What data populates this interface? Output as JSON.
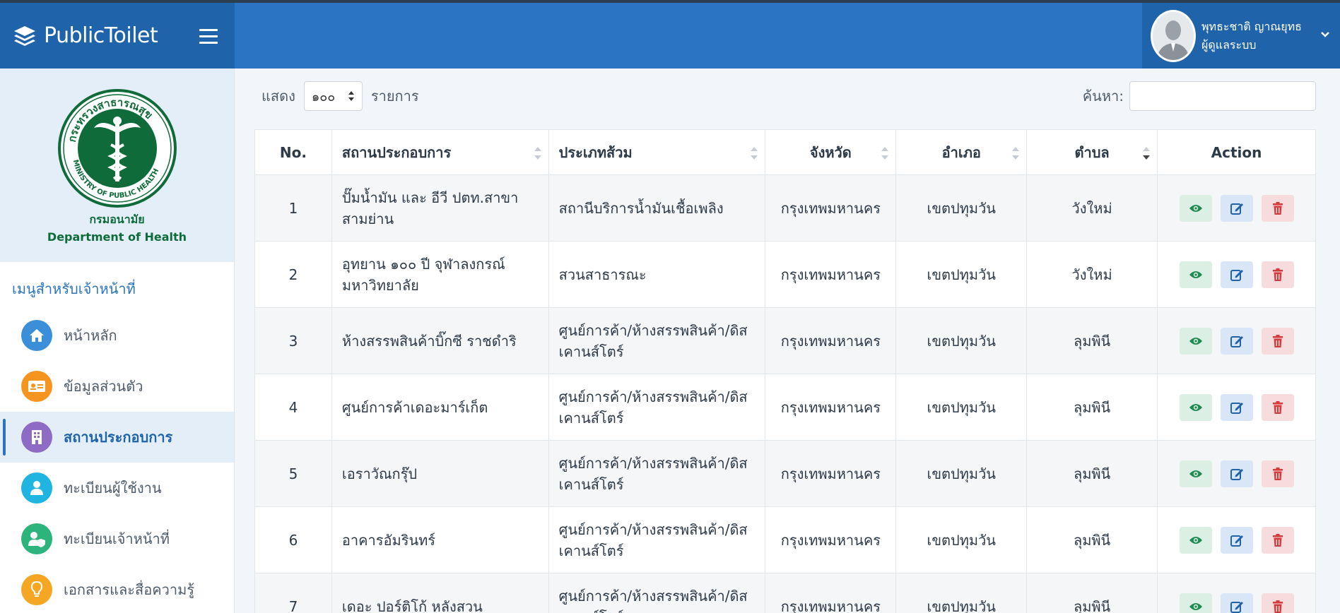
{
  "header": {
    "brand_name": "PublicToilet",
    "user_name": "พุทธะชาติ ญาณยุทธ",
    "user_role": "ผู้ดูแลระบบ"
  },
  "sidebar": {
    "org_name_th": "กรมอนามัย",
    "org_name_en": "Department of Health",
    "menu_heading": "เมนูสำหรับเจ้าหน้าที่",
    "items": [
      {
        "label": "หน้าหลัก",
        "icon": "home-icon",
        "color": "#3b8fd9"
      },
      {
        "label": "ข้อมูลส่วนตัว",
        "icon": "id-card-icon",
        "color": "#f5951f"
      },
      {
        "label": "สถานประกอบการ",
        "icon": "building-icon",
        "color": "#8e6bc4",
        "active": true
      },
      {
        "label": "ทะเบียนผู้ใช้งาน",
        "icon": "user-icon",
        "color": "#1fb5e0"
      },
      {
        "label": "ทะเบียนเจ้าหน้าที่",
        "icon": "user-shield-icon",
        "color": "#2db37c"
      },
      {
        "label": "เอกสารและสื่อความรู้",
        "icon": "lightbulb-icon",
        "color": "#f5a623"
      }
    ]
  },
  "list_controls": {
    "show_label": "แสดง",
    "page_length": "๑๐๐",
    "entries_label": "รายการ",
    "search_label": "ค้นหา:"
  },
  "table": {
    "columns": [
      "No.",
      "สถานประกอบการ",
      "ประเภทส้วม",
      "จังหวัด",
      "อำเภอ",
      "ตำบล",
      "Action"
    ],
    "rows": [
      {
        "no": "1",
        "name": "ปั๊มน้ำมัน และ อีวี ปตท.สาขาสามย่าน",
        "type": "สถานีบริการน้ำมันเชื้อเพลิง",
        "province": "กรุงเทพมหานคร",
        "district": "เขตปทุมวัน",
        "subdistrict": "วังใหม่"
      },
      {
        "no": "2",
        "name": "อุทยาน ๑๐๐ ปี จุฬาลงกรณ์มหาวิทยาลัย",
        "type": "สวนสาธารณะ",
        "province": "กรุงเทพมหานคร",
        "district": "เขตปทุมวัน",
        "subdistrict": "วังใหม่"
      },
      {
        "no": "3",
        "name": "ห้างสรรพสินค้าบิ๊กซี ราชดำริ",
        "type": "ศูนย์การค้า/ห้างสรรพสินค้า/ดิสเคานส์โตร์",
        "province": "กรุงเทพมหานคร",
        "district": "เขตปทุมวัน",
        "subdistrict": "ลุมพินี"
      },
      {
        "no": "4",
        "name": "ศูนย์การค้าเดอะมาร์เก็ต",
        "type": "ศูนย์การค้า/ห้างสรรพสินค้า/ดิสเคานส์โตร์",
        "province": "กรุงเทพมหานคร",
        "district": "เขตปทุมวัน",
        "subdistrict": "ลุมพินี"
      },
      {
        "no": "5",
        "name": "เอราวัณกรุ๊ป",
        "type": "ศูนย์การค้า/ห้างสรรพสินค้า/ดิสเคานส์โตร์",
        "province": "กรุงเทพมหานคร",
        "district": "เขตปทุมวัน",
        "subdistrict": "ลุมพินี"
      },
      {
        "no": "6",
        "name": "อาคารอัมรินทร์",
        "type": "ศูนย์การค้า/ห้างสรรพสินค้า/ดิสเคานส์โตร์",
        "province": "กรุงเทพมหานคร",
        "district": "เขตปทุมวัน",
        "subdistrict": "ลุมพินี"
      },
      {
        "no": "7",
        "name": "เดอะ ปอร์ติโก้ หลังสวน",
        "type": "ศูนย์การค้า/ห้างสรรพสินค้า/ดิสเคานส์โตร์",
        "province": "กรุงเทพมหานคร",
        "district": "เขตปทุมวัน",
        "subdistrict": "ลุมพินี"
      }
    ]
  },
  "colors": {
    "primary": "#2a74c3",
    "primary_dark": "#1f63aa",
    "view": "#1e8a52",
    "edit": "#1f63aa",
    "delete": "#d63b3b"
  }
}
